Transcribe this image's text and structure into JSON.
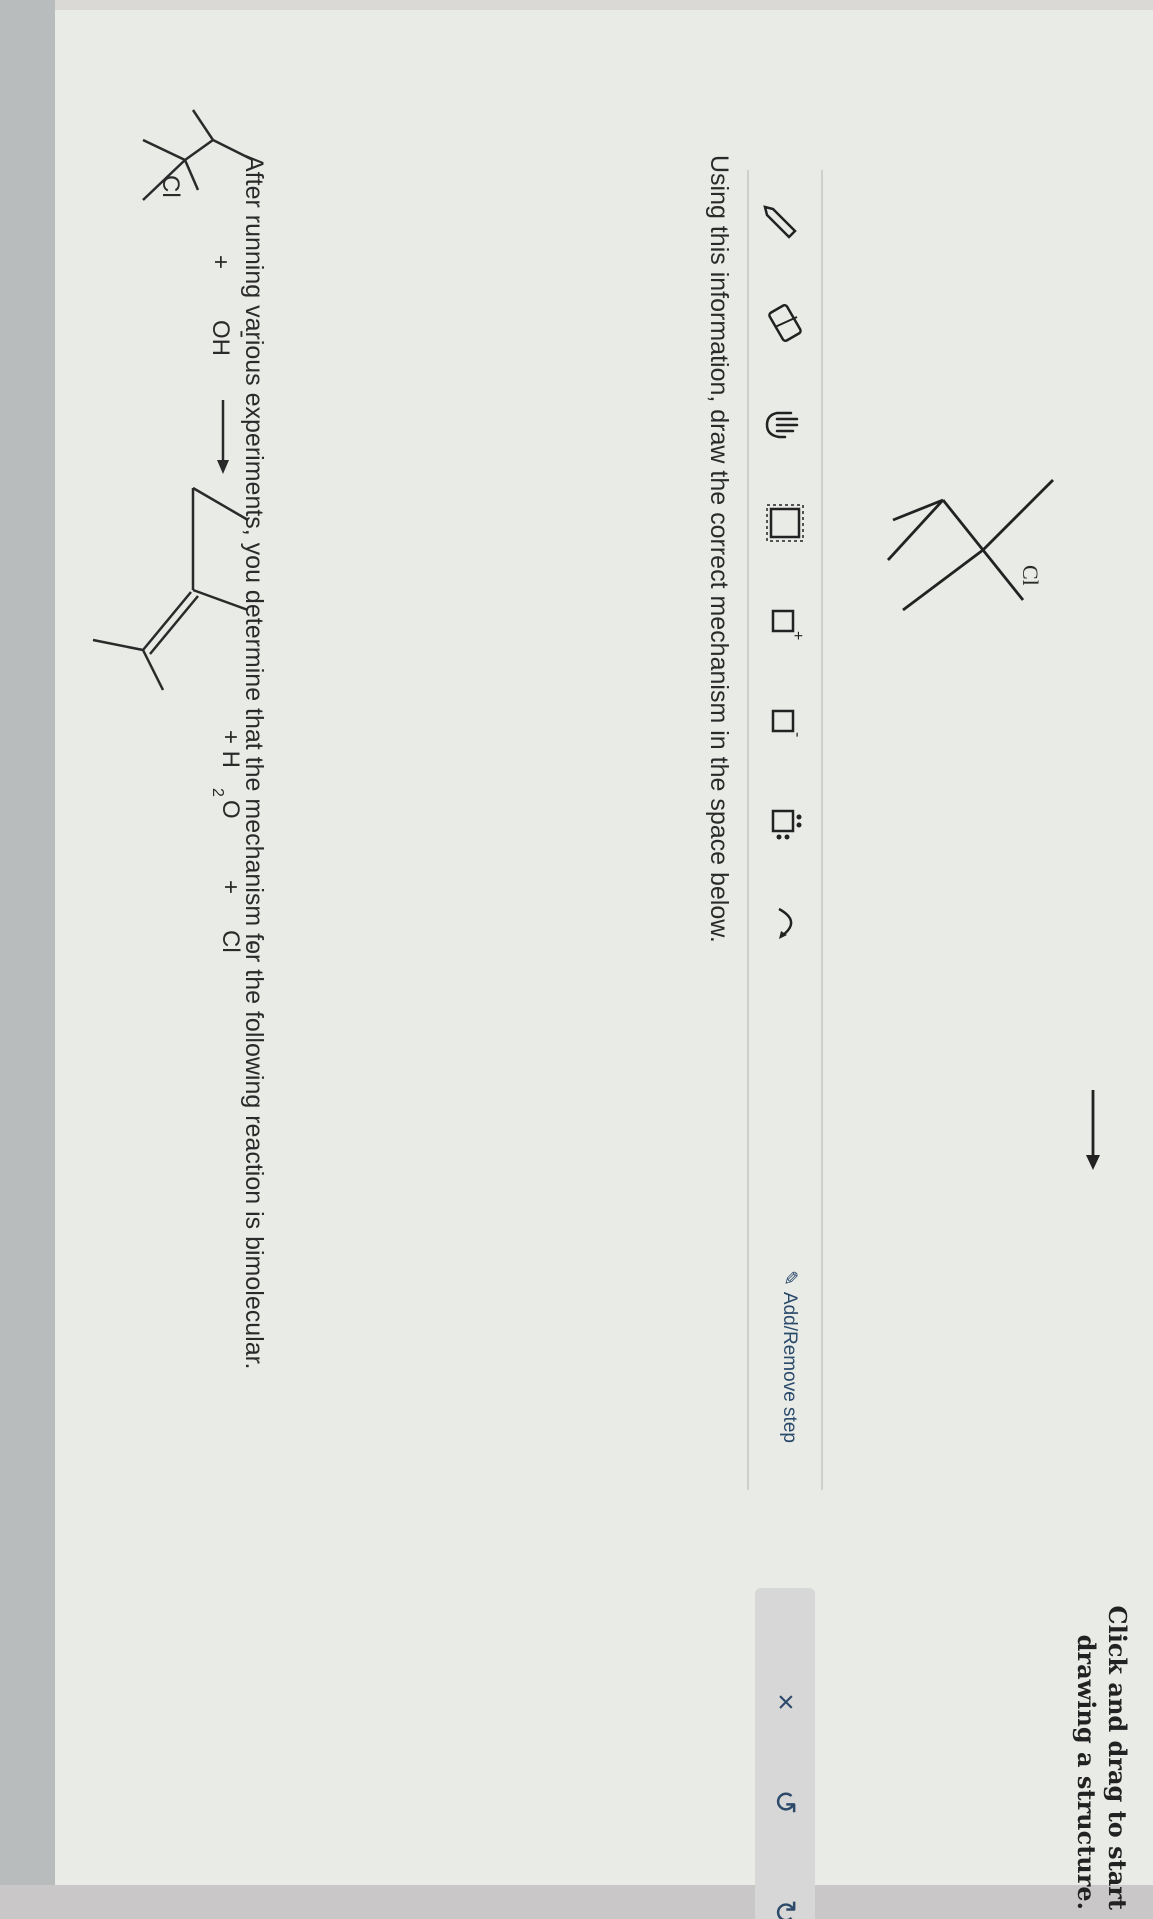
{
  "question": {
    "text": "After running various experiments, you determine that the mechanism for the following reaction is bimolecular."
  },
  "reaction": {
    "reactant_label": "Cl",
    "plus1": "+",
    "nucleophile": "OH",
    "nucleophile_charge": "-",
    "product_plus1": "+ H",
    "water_sub": "2",
    "water_o": "O",
    "product_plus2": "+",
    "chloride": "Cl",
    "chloride_charge": "-"
  },
  "instruction": {
    "text": "Using this information, draw the correct mechanism in the space below."
  },
  "toolbar": {
    "tools": [
      {
        "name": "pencil-icon"
      },
      {
        "name": "eraser-icon"
      },
      {
        "name": "hand-icon"
      },
      {
        "name": "select-box-icon"
      },
      {
        "name": "positive-charge-icon",
        "sup": "+"
      },
      {
        "name": "negative-charge-icon",
        "sup": "-"
      },
      {
        "name": "lone-pair-icon"
      },
      {
        "name": "curved-arrow-icon"
      }
    ],
    "add_remove_label": "Add/Remove step"
  },
  "panel": {
    "close_label": "×",
    "undo_label": "↺",
    "redo_label": "↻"
  },
  "canvas": {
    "structure_label": "Cl",
    "hint": "Click and drag to start drawing a structure."
  }
}
